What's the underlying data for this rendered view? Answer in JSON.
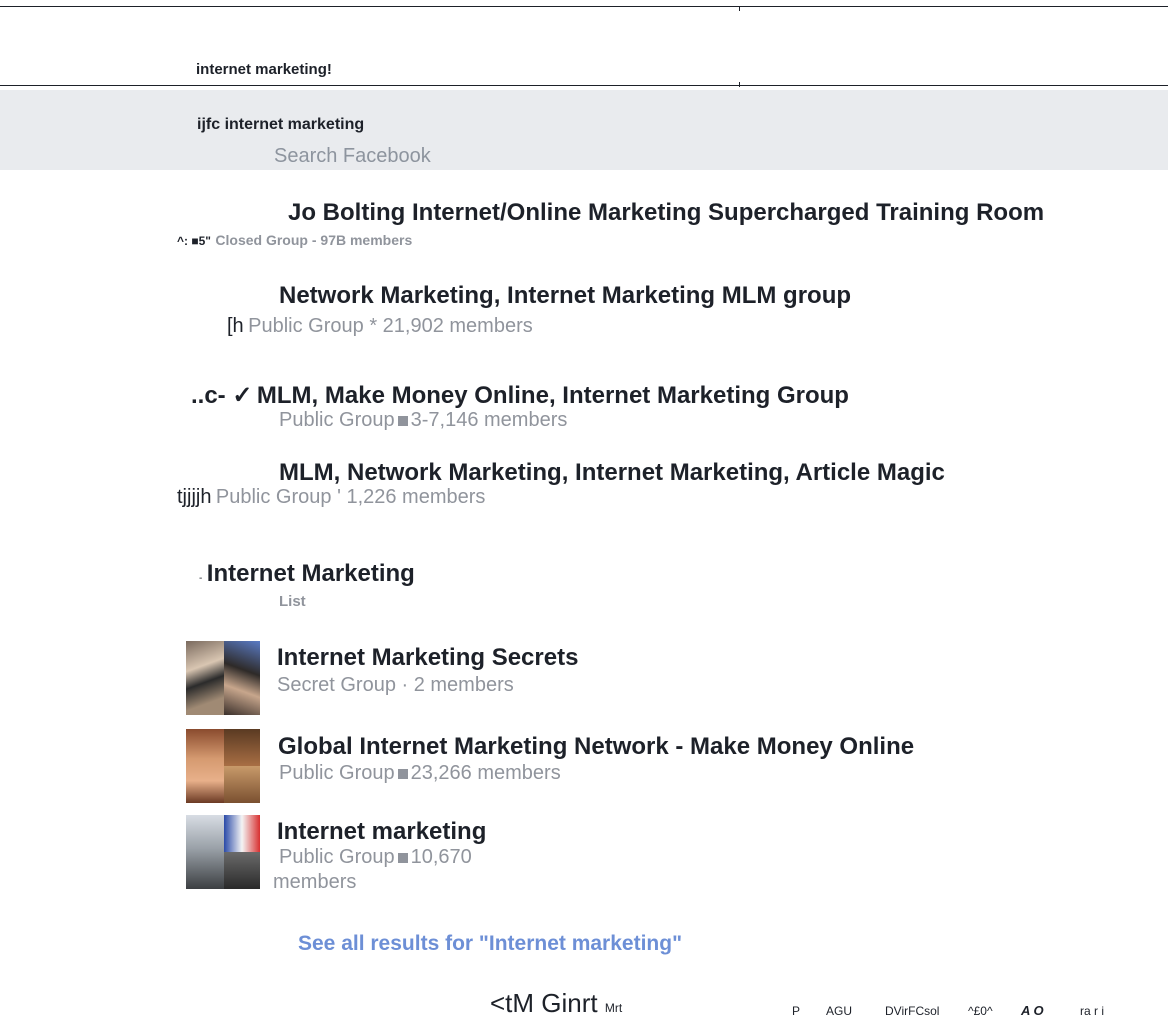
{
  "search": {
    "query_top": "internet marketing!",
    "query_current": "ijfc internet marketing",
    "placeholder": "Search Facebook"
  },
  "results": [
    {
      "prefix": "^: ■5\"",
      "title": "Jo Bolting Internet/Online Marketing Supercharged Training Room",
      "meta": "Closed Group - 97B members"
    },
    {
      "prefix": "[h",
      "title": "Network Marketing, Internet Marketing MLM group",
      "meta": "Public Group * 21,902 members"
    },
    {
      "prefix": "..c- ✓",
      "title": "MLM, Make Money Online, Internet Marketing Group",
      "meta_type": "Public Group",
      "meta_count": "3-7,146 members"
    },
    {
      "prefix": "tjjjjh",
      "title": "MLM, Network Marketing, Internet Marketing, Article Magic",
      "meta": "Public Group ' 1,226 members"
    },
    {
      "prefix": "-",
      "title": "Internet Marketing",
      "meta": "List"
    },
    {
      "title": "Internet Marketing Secrets",
      "meta": "Secret Group · 2 members"
    },
    {
      "title": "Global Internet Marketing Network - Make Money Online",
      "meta_type": "Public Group",
      "meta_count": "23,266 members"
    },
    {
      "title": "Internet marketing",
      "meta_type": "Public Group",
      "meta_count_line1": "10,670",
      "meta_count_line2": "members"
    }
  ],
  "see_all": "See all results for \"Internet marketing\"",
  "footer": {
    "big": "<tM Ginrt",
    "small": "Mrt",
    "items": [
      "P",
      "AGU",
      "DVirFCsol",
      "^£0^",
      "A O",
      "ra r  i"
    ]
  }
}
